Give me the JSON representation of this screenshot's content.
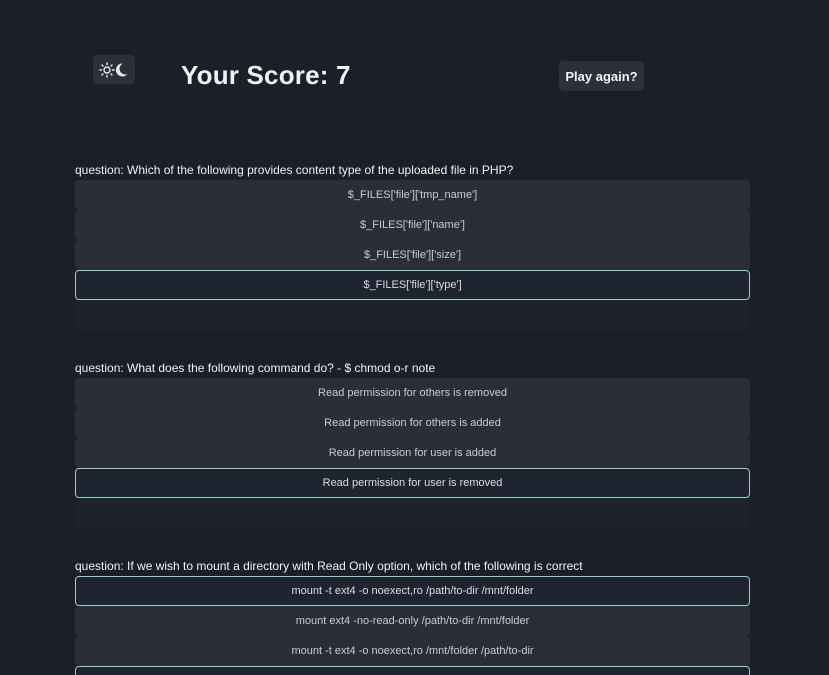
{
  "header": {
    "theme_toggle_icon": "sun-moon-icon",
    "score_text": "Your Score: 7",
    "play_again_label": "Play again?"
  },
  "questions": [
    {
      "text": "question: Which of the following provides content type of the uploaded file in PHP?",
      "answers": [
        {
          "label": "$_FILES['file']['tmp_name']",
          "selected": false
        },
        {
          "label": "$_FILES['file']['name']",
          "selected": false
        },
        {
          "label": "$_FILES['file']['size']",
          "selected": false
        },
        {
          "label": "$_FILES['file']['type']",
          "selected": true
        }
      ]
    },
    {
      "text": "question: What does the following command do? - $ chmod o-r note",
      "answers": [
        {
          "label": "Read permission for others is removed",
          "selected": false
        },
        {
          "label": "Read permission for others is added",
          "selected": false
        },
        {
          "label": "Read permission for user is added",
          "selected": false
        },
        {
          "label": "Read permission for user is removed",
          "selected": true
        }
      ]
    },
    {
      "text": "question: If we wish to mount a directory with Read Only option, which of the following is correct",
      "answers": [
        {
          "label": "mount -t ext4 -o noexect,ro /path/to-dir /mnt/folder",
          "selected": true
        },
        {
          "label": "mount ext4 -no-read-only /path/to-dir /mnt/folder",
          "selected": false
        },
        {
          "label": "mount -t ext4 -o noexect,ro /mnt/folder /path/to-dir",
          "selected": false
        },
        {
          "label": "",
          "selected": true
        }
      ]
    }
  ],
  "colors": {
    "background": "#1a1f29",
    "answer_bg": "#2a2e38",
    "selected_border": "#8fd5c9"
  }
}
